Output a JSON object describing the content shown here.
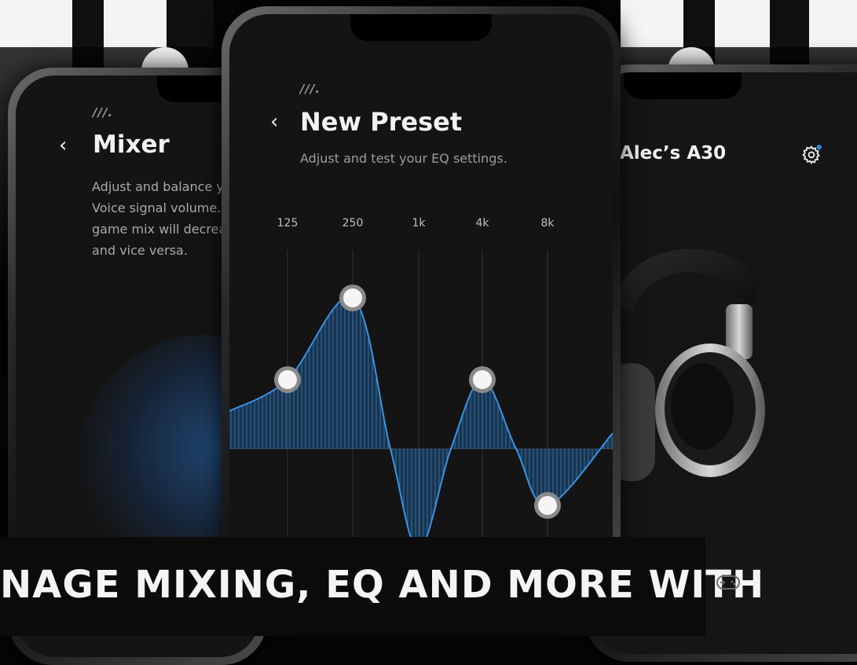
{
  "colors": {
    "accent": "#2f86d8",
    "background": "#050505",
    "screen": "#141414"
  },
  "left_phone": {
    "brand_mark": "///.",
    "back_icon": "chevron-left-icon",
    "title": "Mixer",
    "description": "Adjust and balance y\nVoice signal volume. I\ngame mix will decrea\nand vice versa."
  },
  "center_phone": {
    "brand_mark": "///.",
    "back_icon": "chevron-left-icon",
    "title": "New Preset",
    "subtitle": "Adjust and test your EQ settings.",
    "bands": [
      "125",
      "250",
      "1k",
      "4k",
      "8k"
    ],
    "band_gains": [
      0.22,
      0.48,
      0.0,
      0.22,
      -0.18
    ]
  },
  "right_phone": {
    "title": "Alec’s A30",
    "settings_icon": "gear-icon",
    "notification_dot": true
  },
  "banner": {
    "text": "NAGE MIXING, EQ AND MORE WITH",
    "icon": "gamepad-icon"
  }
}
